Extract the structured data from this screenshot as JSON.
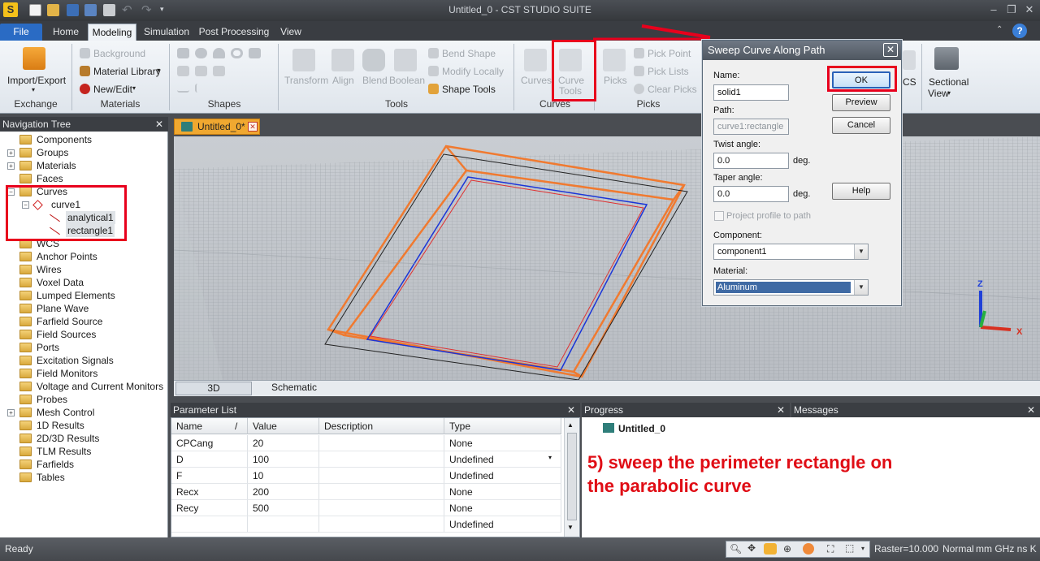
{
  "window": {
    "title": "Untitled_0 - CST STUDIO SUITE"
  },
  "ribbon_tabs": [
    "File",
    "Home",
    "Modeling",
    "Simulation",
    "Post Processing",
    "View"
  ],
  "ribbon": {
    "exchange": {
      "button": "Import/Export",
      "label": "Exchange"
    },
    "materials": {
      "background": "Background",
      "library": "Material Library",
      "new_edit": "New/Edit",
      "label": "Materials"
    },
    "shapes": {
      "label": "Shapes"
    },
    "tools": {
      "transform": "Transform",
      "align": "Align",
      "blend": "Blend",
      "boolean": "Boolean",
      "bend_shape": "Bend Shape",
      "modify_locally": "Modify Locally",
      "shape_tools": "Shape Tools",
      "label": "Tools"
    },
    "curves": {
      "curves": "Curves",
      "curve_tools_1": "Curve",
      "curve_tools_2": "Tools",
      "label": "Curves"
    },
    "picks": {
      "picks": "Picks",
      "pick_point": "Pick Point",
      "pick_lists": "Pick Lists",
      "clear_picks": "Clear Picks",
      "label": "Picks"
    },
    "wcs": {
      "label": "CS"
    },
    "sectional": {
      "line1": "Sectional",
      "line2": "View"
    }
  },
  "navigation": {
    "title": "Navigation Tree",
    "items": [
      {
        "label": "Components",
        "exp": "",
        "level": 0
      },
      {
        "label": "Groups",
        "exp": "+",
        "level": 0
      },
      {
        "label": "Materials",
        "exp": "+",
        "level": 0
      },
      {
        "label": "Faces",
        "exp": "",
        "level": 0
      },
      {
        "label": "Curves",
        "exp": "-",
        "level": 0
      },
      {
        "label": "curve1",
        "exp": "-",
        "level": 1
      },
      {
        "label": "analytical1",
        "exp": "",
        "level": 2
      },
      {
        "label": "rectangle1",
        "exp": "",
        "level": 2
      },
      {
        "label": "WCS",
        "exp": "",
        "level": 0
      },
      {
        "label": "Anchor Points",
        "exp": "",
        "level": 0
      },
      {
        "label": "Wires",
        "exp": "",
        "level": 0
      },
      {
        "label": "Voxel Data",
        "exp": "",
        "level": 0
      },
      {
        "label": "Lumped Elements",
        "exp": "",
        "level": 0
      },
      {
        "label": "Plane Wave",
        "exp": "",
        "level": 0
      },
      {
        "label": "Farfield Source",
        "exp": "",
        "level": 0
      },
      {
        "label": "Field Sources",
        "exp": "",
        "level": 0
      },
      {
        "label": "Ports",
        "exp": "",
        "level": 0
      },
      {
        "label": "Excitation Signals",
        "exp": "",
        "level": 0
      },
      {
        "label": "Field Monitors",
        "exp": "",
        "level": 0
      },
      {
        "label": "Voltage and Current Monitors",
        "exp": "",
        "level": 0
      },
      {
        "label": "Probes",
        "exp": "",
        "level": 0
      },
      {
        "label": "Mesh Control",
        "exp": "+",
        "level": 0
      },
      {
        "label": "1D Results",
        "exp": "",
        "level": 0
      },
      {
        "label": "2D/3D Results",
        "exp": "",
        "level": 0
      },
      {
        "label": "TLM Results",
        "exp": "",
        "level": 0
      },
      {
        "label": "Farfields",
        "exp": "",
        "level": 0
      },
      {
        "label": "Tables",
        "exp": "",
        "level": 0
      }
    ]
  },
  "document_tab": "Untitled_0*",
  "view_tabs": {
    "tab_3d": "3D",
    "tab_schematic": "Schematic"
  },
  "parameter_list": {
    "title": "Parameter List",
    "columns": [
      "Name",
      "/",
      "Value",
      "Description",
      "Type"
    ],
    "rows": [
      {
        "name": "CPCang",
        "value": "20",
        "description": "",
        "type": "None"
      },
      {
        "name": "D",
        "value": "100",
        "description": "",
        "type": "Undefined"
      },
      {
        "name": "F",
        "value": "10",
        "description": "",
        "type": "Undefined"
      },
      {
        "name": "Recx",
        "value": "200",
        "description": "",
        "type": "None"
      },
      {
        "name": "Recy",
        "value": "500",
        "description": "",
        "type": "None"
      },
      {
        "name": "",
        "value": "",
        "description": "",
        "type": "Undefined"
      }
    ]
  },
  "progress": {
    "title": "Progress",
    "item": "Untitled_0"
  },
  "messages": {
    "title": "Messages"
  },
  "annotation": {
    "line1": "5) sweep the perimeter rectangle on",
    "line2": "the parabolic curve"
  },
  "axes": {
    "z": "Z",
    "x": "X"
  },
  "dialog": {
    "title": "Sweep Curve Along Path",
    "name_label": "Name:",
    "name_value": "solid1",
    "path_label": "Path:",
    "path_value": "curve1:rectangle",
    "twist_label": "Twist angle:",
    "twist_value": "0.0",
    "twist_unit": "deg.",
    "taper_label": "Taper angle:",
    "taper_value": "0.0",
    "taper_unit": "deg.",
    "project_label": "Project profile to path",
    "component_label": "Component:",
    "component_value": "component1",
    "material_label": "Material:",
    "material_value": "Aluminum",
    "ok": "OK",
    "preview": "Preview",
    "cancel": "Cancel",
    "help": "Help"
  },
  "status": {
    "ready": "Ready",
    "raster": "Raster=10.000",
    "mode": "Normal",
    "units": "mm  GHz  ns  K"
  },
  "colors": {
    "annotation": "#e00d15",
    "highlight_box": "#e8001c",
    "file_tab": "#2a6bc4",
    "doc_tab": "#f0a830",
    "sweep_outline": "#f07a30"
  }
}
